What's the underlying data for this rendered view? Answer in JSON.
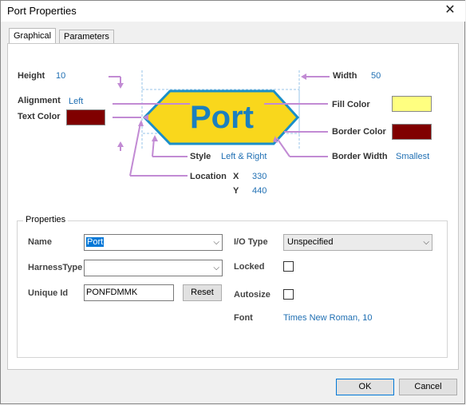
{
  "window": {
    "title": "Port Properties"
  },
  "tabs": [
    {
      "label": "Graphical"
    },
    {
      "label": "Parameters"
    }
  ],
  "graphic": {
    "height_label": "Height",
    "height_value": "10",
    "alignment_label": "Alignment",
    "alignment_value": "Left",
    "text_color_label": "Text Color",
    "width_label": "Width",
    "width_value": "50",
    "fill_color_label": "Fill Color",
    "border_color_label": "Border Color",
    "border_width_label": "Border Width",
    "border_width_value": "Smallest",
    "style_label": "Style",
    "style_value": "Left & Right",
    "location_label": "Location",
    "x_label": "X",
    "x_value": "330",
    "y_label": "Y",
    "y_value": "440",
    "port_text": "Port",
    "colors": {
      "text": "#800000",
      "fill": "#ffff80",
      "border": "#800000",
      "port_fill": "#f9d71c",
      "port_stroke": "#1b8fc8",
      "port_text": "#1b7fbf",
      "leader": "#c28bd4"
    }
  },
  "properties": {
    "title": "Properties",
    "name_label": "Name",
    "name_value": "Port",
    "harness_label": "HarnessType",
    "harness_value": "",
    "unique_id_label": "Unique Id",
    "unique_id_value": "PONFDMMK",
    "reset_label": "Reset",
    "io_type_label": "I/O Type",
    "io_type_value": "Unspecified",
    "locked_label": "Locked",
    "autosize_label": "Autosize",
    "font_label": "Font",
    "font_value": "Times New Roman, 10"
  },
  "footer": {
    "ok_label": "OK",
    "cancel_label": "Cancel"
  }
}
